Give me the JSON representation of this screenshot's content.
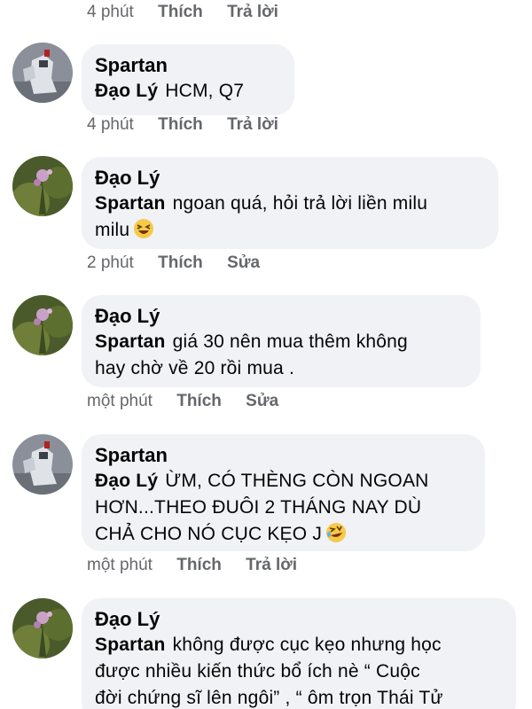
{
  "top_actions": {
    "time": "4 phút",
    "like": "Thích",
    "second": "Trả lời"
  },
  "comments": [
    {
      "author": "Spartan",
      "avatar": "gundam-avatar",
      "tag": "Đạo Lý",
      "lines": [
        "HCM, Q7"
      ],
      "emoji": null,
      "time": "4 phút",
      "like": "Thích",
      "second": "Trả lời"
    },
    {
      "author": "Đạo Lý",
      "avatar": "plant-avatar",
      "tag": "Spartan",
      "lines": [
        "ngoan quá, hỏi trả lời liền milu",
        "milu"
      ],
      "emoji": "laughing-emoji",
      "time": "2 phút",
      "like": "Thích",
      "second": "Sửa"
    },
    {
      "author": "Đạo Lý",
      "avatar": "plant-avatar",
      "tag": "Spartan",
      "lines": [
        "giá 30 nên mua thêm không",
        "hay chờ về 20 rồi mua ."
      ],
      "emoji": null,
      "time": "một phút",
      "like": "Thích",
      "second": "Sửa"
    },
    {
      "author": "Spartan",
      "avatar": "gundam-avatar",
      "tag": "Đạo Lý",
      "lines": [
        "ỪM, CÓ THÈNG CÒN NGOAN",
        "HƠN...THEO ĐUÔI 2 THÁNG NAY DÙ",
        "CHẢ CHO NÓ CỤC KẸO J"
      ],
      "emoji": "rofl-emoji",
      "time": "một phút",
      "like": "Thích",
      "second": "Trả lời"
    },
    {
      "author": "Đạo Lý",
      "avatar": "plant-avatar",
      "tag": "Spartan",
      "lines": [
        "không được cục kẹo nhưng học",
        "được nhiều kiến thức bổ ích nè “ Cuộc",
        "đời chứng sĩ lên ngôi” , “ ôm trọn Thái Tử"
      ],
      "emoji": null,
      "time": null,
      "like": null,
      "second": null
    }
  ],
  "colors": {
    "bubble": "#f0f2f5",
    "meta_text": "#65676b",
    "text": "#050505"
  }
}
